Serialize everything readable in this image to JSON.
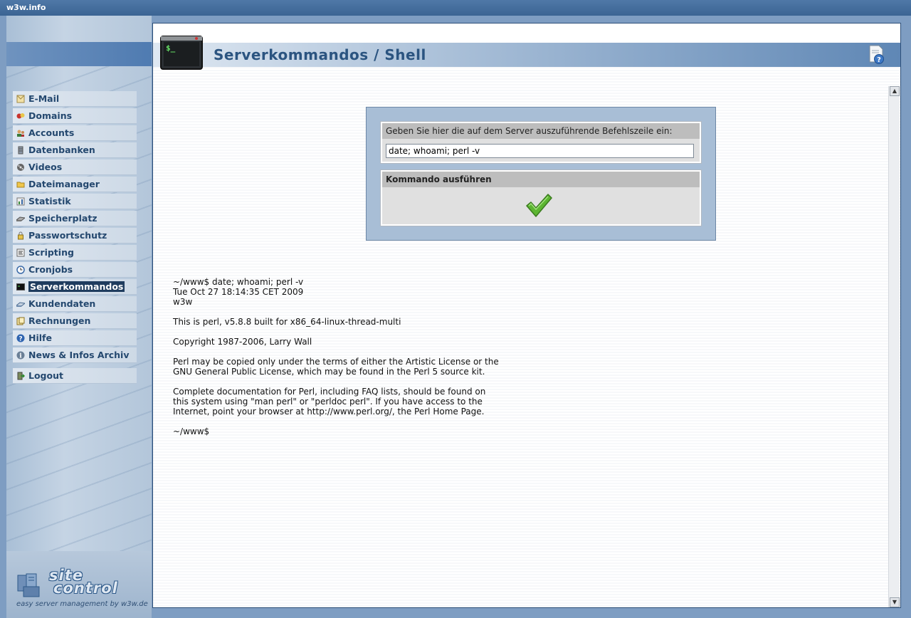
{
  "window": {
    "title": "w3w.info"
  },
  "sidebar": {
    "items": [
      {
        "label": "E-Mail",
        "icon": "mail-icon"
      },
      {
        "label": "Domains",
        "icon": "domains-icon"
      },
      {
        "label": "Accounts",
        "icon": "accounts-icon"
      },
      {
        "label": "Datenbanken",
        "icon": "database-icon"
      },
      {
        "label": "Videos",
        "icon": "videos-icon"
      },
      {
        "label": "Dateimanager",
        "icon": "folder-icon"
      },
      {
        "label": "Statistik",
        "icon": "statistics-icon"
      },
      {
        "label": "Speicherplatz",
        "icon": "storage-icon"
      },
      {
        "label": "Passwortschutz",
        "icon": "lock-icon"
      },
      {
        "label": "Scripting",
        "icon": "scripting-icon"
      },
      {
        "label": "Cronjobs",
        "icon": "clock-icon"
      },
      {
        "label": "Serverkommandos",
        "icon": "terminal-icon",
        "active": true
      },
      {
        "label": "Kundendaten",
        "icon": "customer-icon"
      },
      {
        "label": "Rechnungen",
        "icon": "invoice-icon"
      },
      {
        "label": "Hilfe",
        "icon": "help-icon"
      },
      {
        "label": "News & Infos Archiv",
        "icon": "info-icon"
      }
    ],
    "logout": {
      "label": "Logout",
      "icon": "logout-icon"
    }
  },
  "logo": {
    "line1": "site",
    "line2": "control",
    "tagline": "easy server management by w3w.de"
  },
  "page": {
    "title": "Serverkommandos / Shell"
  },
  "form": {
    "prompt_label": "Geben Sie hier die auf dem Server auszuführende Befehlszeile ein:",
    "command_value": "date; whoami; perl -v",
    "execute_label": "Kommando ausführen"
  },
  "output": {
    "lines": [
      "~/www$ date; whoami; perl -v",
      "Tue Oct 27 18:14:35 CET 2009",
      "w3w",
      "",
      "This is perl, v5.8.8 built for x86_64-linux-thread-multi",
      "",
      "Copyright 1987-2006, Larry Wall",
      "",
      "Perl may be copied only under the terms of either the Artistic License or the",
      "GNU General Public License, which may be found in the Perl 5 source kit.",
      "",
      "Complete documentation for Perl, including FAQ lists, should be found on",
      "this system using \"man perl\" or \"perldoc perl\". If you have access to the",
      "Internet, point your browser at http://www.perl.org/, the Perl Home Page.",
      "",
      "~/www$"
    ]
  },
  "colors": {
    "accent": "#2b5480",
    "active_menu": "#1f3c5e",
    "check_green": "#5cb531"
  }
}
